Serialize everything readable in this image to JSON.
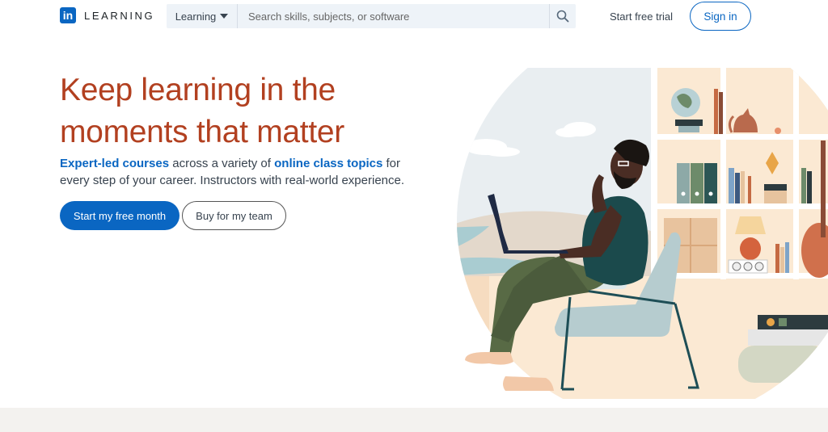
{
  "header": {
    "logo_mark": "in",
    "logo_text": "LEARNING",
    "search_category": "Learning",
    "search_placeholder": "Search skills, subjects, or software",
    "start_trial": "Start free trial",
    "sign_in": "Sign in"
  },
  "hero": {
    "title": "Keep learning in the moments that matter",
    "subtitle_link1": "Expert-led courses",
    "subtitle_text1": " across a variety of ",
    "subtitle_link2": "online class topics",
    "subtitle_text2": " for every step of your career. Instructors with real-world experience.",
    "primary_button": "Start my free month",
    "secondary_button": "Buy for my team"
  },
  "colors": {
    "brand_blue": "#0a66c2",
    "title_accent": "#b24020",
    "search_bg": "#eef3f8",
    "footer_band": "#f3f2ef"
  },
  "icons": {
    "search": "search-icon",
    "caret": "caret-down-icon"
  }
}
